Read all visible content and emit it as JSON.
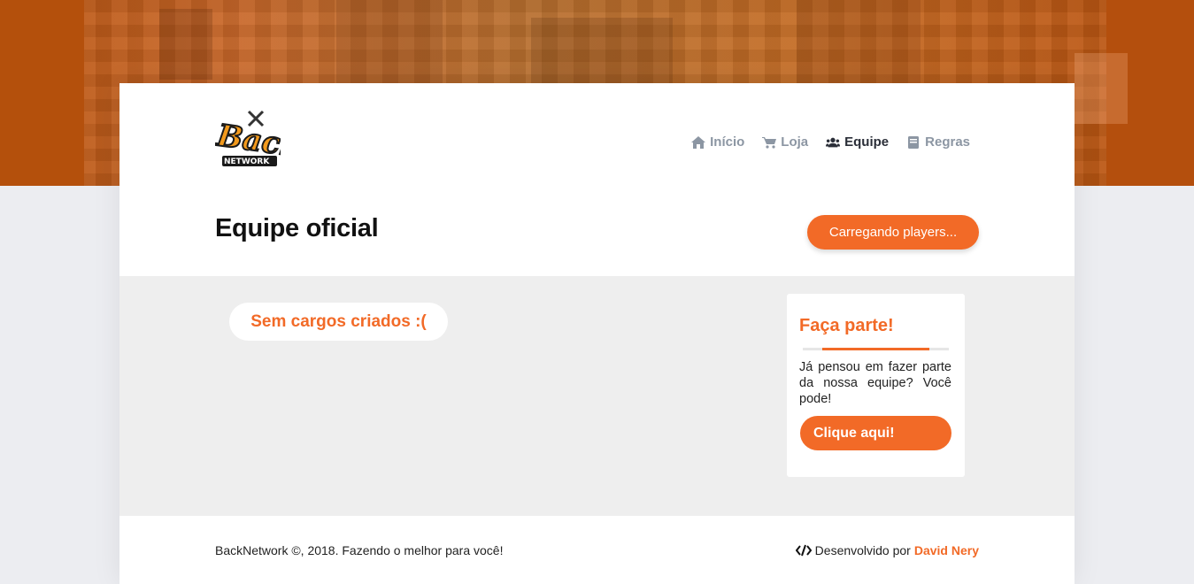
{
  "brand": {
    "logo_text": "Back",
    "logo_sub": "NETWORK"
  },
  "nav": {
    "items": [
      {
        "label": "Início",
        "icon": "home-icon",
        "active": false
      },
      {
        "label": "Loja",
        "icon": "cart-icon",
        "active": false
      },
      {
        "label": "Equipe",
        "icon": "users-icon",
        "active": true
      },
      {
        "label": "Regras",
        "icon": "book-icon",
        "active": false
      }
    ]
  },
  "page": {
    "title": "Equipe oficial",
    "loading_button": "Carregando players..."
  },
  "main": {
    "empty_message": "Sem cargos criados :("
  },
  "sidebar": {
    "title": "Faça parte!",
    "text": "Já pensou em fazer parte da nossa equipe? Você pode!",
    "button": "Clique aqui!"
  },
  "footer": {
    "copyright": "BackNetwork ©, 2018. Fazendo o melhor para você!",
    "dev_prefix": "Desenvolvido por",
    "dev_name": "David Nery"
  },
  "colors": {
    "accent": "#f26a27",
    "nav_inactive": "#8c96a3",
    "nav_active": "#2a2e38",
    "content_bg": "#eeeeee"
  }
}
